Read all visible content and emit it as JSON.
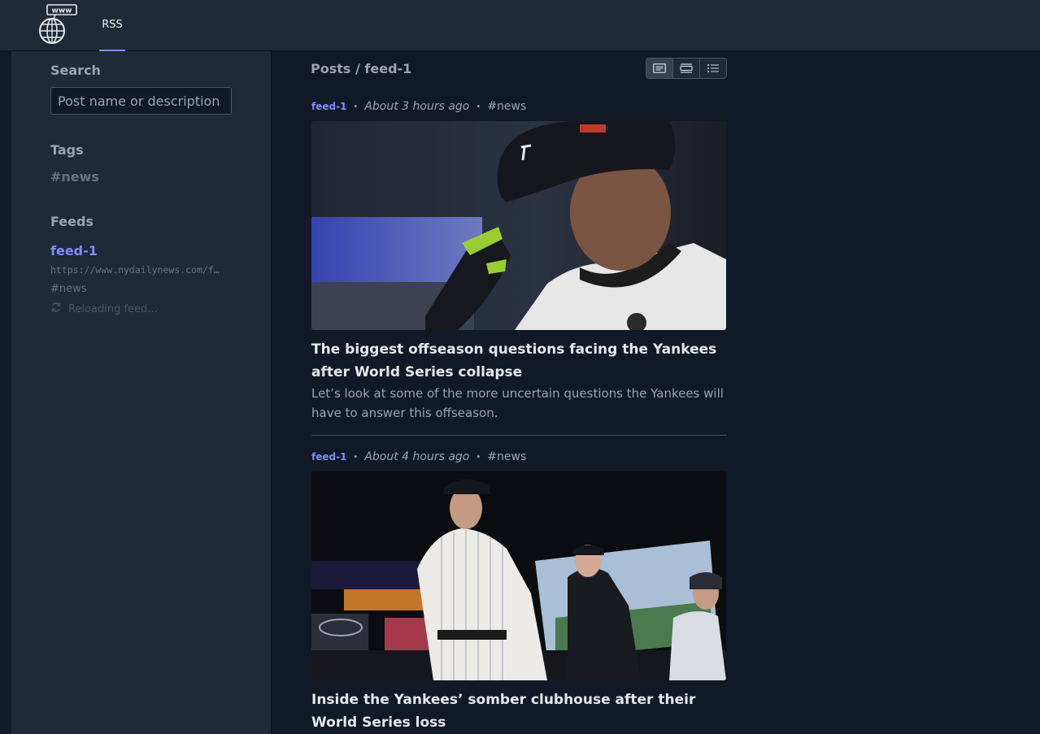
{
  "app": {
    "nav_tab": "RSS",
    "logo_text": "www"
  },
  "sidebar": {
    "search_title": "Search",
    "search_placeholder": "Post name or description",
    "tags_title": "Tags",
    "tags": [
      "#news"
    ],
    "feeds_title": "Feeds",
    "feeds": [
      {
        "name": "feed-1",
        "url": "https://www.nydailynews.com/f…",
        "tag": "#news",
        "status": "Reloading feed..."
      }
    ]
  },
  "main": {
    "breadcrumb": "Posts / feed-1",
    "posts": [
      {
        "feed": "feed-1",
        "time": "About 3 hours ago",
        "tag": "#news",
        "title": "The biggest offseason questions facing the Yankees after World Series collapse",
        "description": "Let’s look at some of the more uncertain questions the Yankees will have to answer this offseason."
      },
      {
        "feed": "feed-1",
        "time": "About 4 hours ago",
        "tag": "#news",
        "title": "Inside the Yankees’ somber clubhouse after their World Series loss",
        "description": ""
      }
    ]
  },
  "colors": {
    "accent": "#818cf8",
    "background": "#111827",
    "panel": "#1f2937"
  }
}
